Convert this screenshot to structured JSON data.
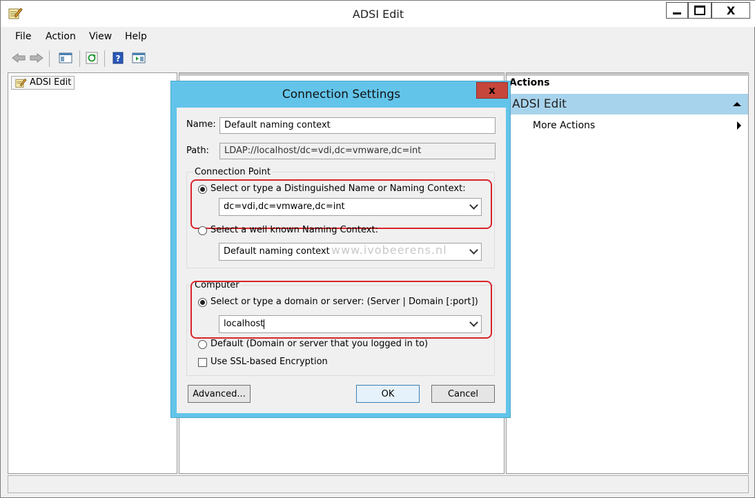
{
  "window": {
    "title": "ADSI Edit",
    "close_glyph": "X"
  },
  "menu": [
    "File",
    "Action",
    "View",
    "Help"
  ],
  "toolbar": {
    "icons": [
      "back-arrow-icon",
      "forward-arrow-icon",
      "show-hide-console-tree-icon",
      "refresh-icon",
      "help-icon",
      "show-hide-action-pane-icon"
    ]
  },
  "tree": {
    "root_label": "ADSI Edit"
  },
  "actions": {
    "header": "Actions",
    "group_title": "ADSI Edit",
    "items": [
      "More Actions"
    ]
  },
  "dialog": {
    "title": "Connection Settings",
    "close_glyph": "x",
    "name_label": "Name:",
    "name_value": "Default naming context",
    "path_label": "Path:",
    "path_value": "LDAP://localhost/dc=vdi,dc=vmware,dc=int",
    "connection_point": {
      "group_label": "Connection Point",
      "option_dn_label": "Select or type a Distinguished Name or Naming Context:",
      "option_dn_selected": true,
      "dn_value": "dc=vdi,dc=vmware,dc=int",
      "option_wk_label": "Select a well known Naming Context:",
      "option_wk_selected": false,
      "wk_value": "Default naming context"
    },
    "computer": {
      "group_label": "Computer",
      "option_server_label": "Select or type a domain or server: (Server | Domain [:port])",
      "option_server_selected": true,
      "server_value": "localhost",
      "option_default_label": "Default (Domain or server that you logged in to)",
      "option_default_selected": false,
      "ssl_label": "Use SSL-based Encryption",
      "ssl_checked": false
    },
    "buttons": {
      "advanced": "Advanced...",
      "ok": "OK",
      "cancel": "Cancel"
    },
    "watermark": "www.ivobeerens.nl"
  },
  "colors": {
    "dialog_frame": "#63c4ea",
    "actions_group": "#a8d3ec",
    "highlight": "#d9232b",
    "close_button": "#c7463c"
  }
}
